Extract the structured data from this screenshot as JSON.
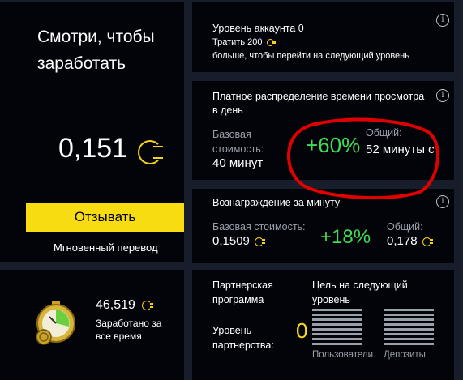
{
  "watch": {
    "title": "Смотри, чтобы заработать",
    "amount": "0,151",
    "button_label": "Отзывать",
    "transfer_label": "Мгновенный перевод"
  },
  "level": {
    "title": "Уровень аккаунта 0",
    "spend_line": "Тратить 200",
    "next_line": "больше, чтобы перейти на следующий уровень"
  },
  "time": {
    "title": "Платное распределение времени просмотра в день",
    "base_label": "Базовая стоимость:",
    "base_value": "40 минут",
    "bonus": "+60%",
    "total_label": "Общий:",
    "total_value": "52 минуты с"
  },
  "reward": {
    "title": "Вознаграждение за минуту",
    "base_label": "Базовая стоимость:",
    "base_value": "0,1509",
    "bonus": "+18%",
    "total_label": "Общий:",
    "total_value": "0,178"
  },
  "earned": {
    "amount": "46,519",
    "label": "Заработано за все время"
  },
  "partner": {
    "title": "Партнерская программа",
    "level_label": "Уровень партнерства:",
    "level_value": "0",
    "goal_title": "Цель на следующий уровень",
    "users_label": "Пользователи",
    "deposits_label": "Депозиты"
  },
  "colors": {
    "accent": "#f8dc12",
    "green": "#3fdc55",
    "annotation": "#e00000"
  }
}
